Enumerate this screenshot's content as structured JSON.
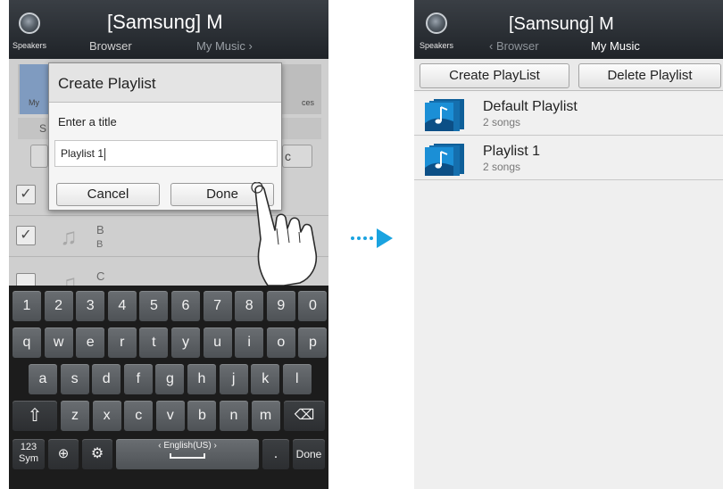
{
  "left_screen": {
    "header": {
      "speaker_label": "Speakers",
      "title": "[Samsung] M",
      "nav_current": "Browser",
      "nav_next": "My Music ›"
    },
    "background_partial": {
      "icon_label_left": "My",
      "icon_label_right": "ces",
      "tab_partial": "S",
      "button_partial": "c",
      "rows": [
        {
          "title": "B",
          "subtitle": "B"
        },
        {
          "title": "C",
          "subtitle": ""
        }
      ]
    },
    "dialog": {
      "title": "Create Playlist",
      "label": "Enter a title",
      "input_value": "Playlist 1",
      "cancel_label": "Cancel",
      "done_label": "Done"
    },
    "keyboard": {
      "row1": [
        "1",
        "2",
        "3",
        "4",
        "5",
        "6",
        "7",
        "8",
        "9",
        "0"
      ],
      "row2": [
        "q",
        "w",
        "e",
        "r",
        "t",
        "y",
        "u",
        "i",
        "o",
        "p"
      ],
      "row3": [
        "a",
        "s",
        "d",
        "f",
        "g",
        "h",
        "j",
        "k",
        "l"
      ],
      "row4": [
        "z",
        "x",
        "c",
        "v",
        "b",
        "n",
        "m"
      ],
      "sym_label_1": "123",
      "sym_label_2": "Sym",
      "language_label": "English(US)",
      "period_label": ".",
      "done_label": "Done"
    }
  },
  "right_screen": {
    "header": {
      "speaker_label": "Speakers",
      "title": "[Samsung] M",
      "nav_prev": "‹  Browser",
      "nav_current": "My Music"
    },
    "buttons": {
      "create_label": "Create PlayList",
      "delete_label": "Delete Playlist"
    },
    "playlists": [
      {
        "name": "Default Playlist",
        "count": "2 songs"
      },
      {
        "name": "Playlist 1",
        "count": "2 songs"
      }
    ]
  },
  "colors": {
    "arrow": "#1aa3e0",
    "header_dark": "#24292e",
    "thumb_blue": "#1b8fd6"
  }
}
